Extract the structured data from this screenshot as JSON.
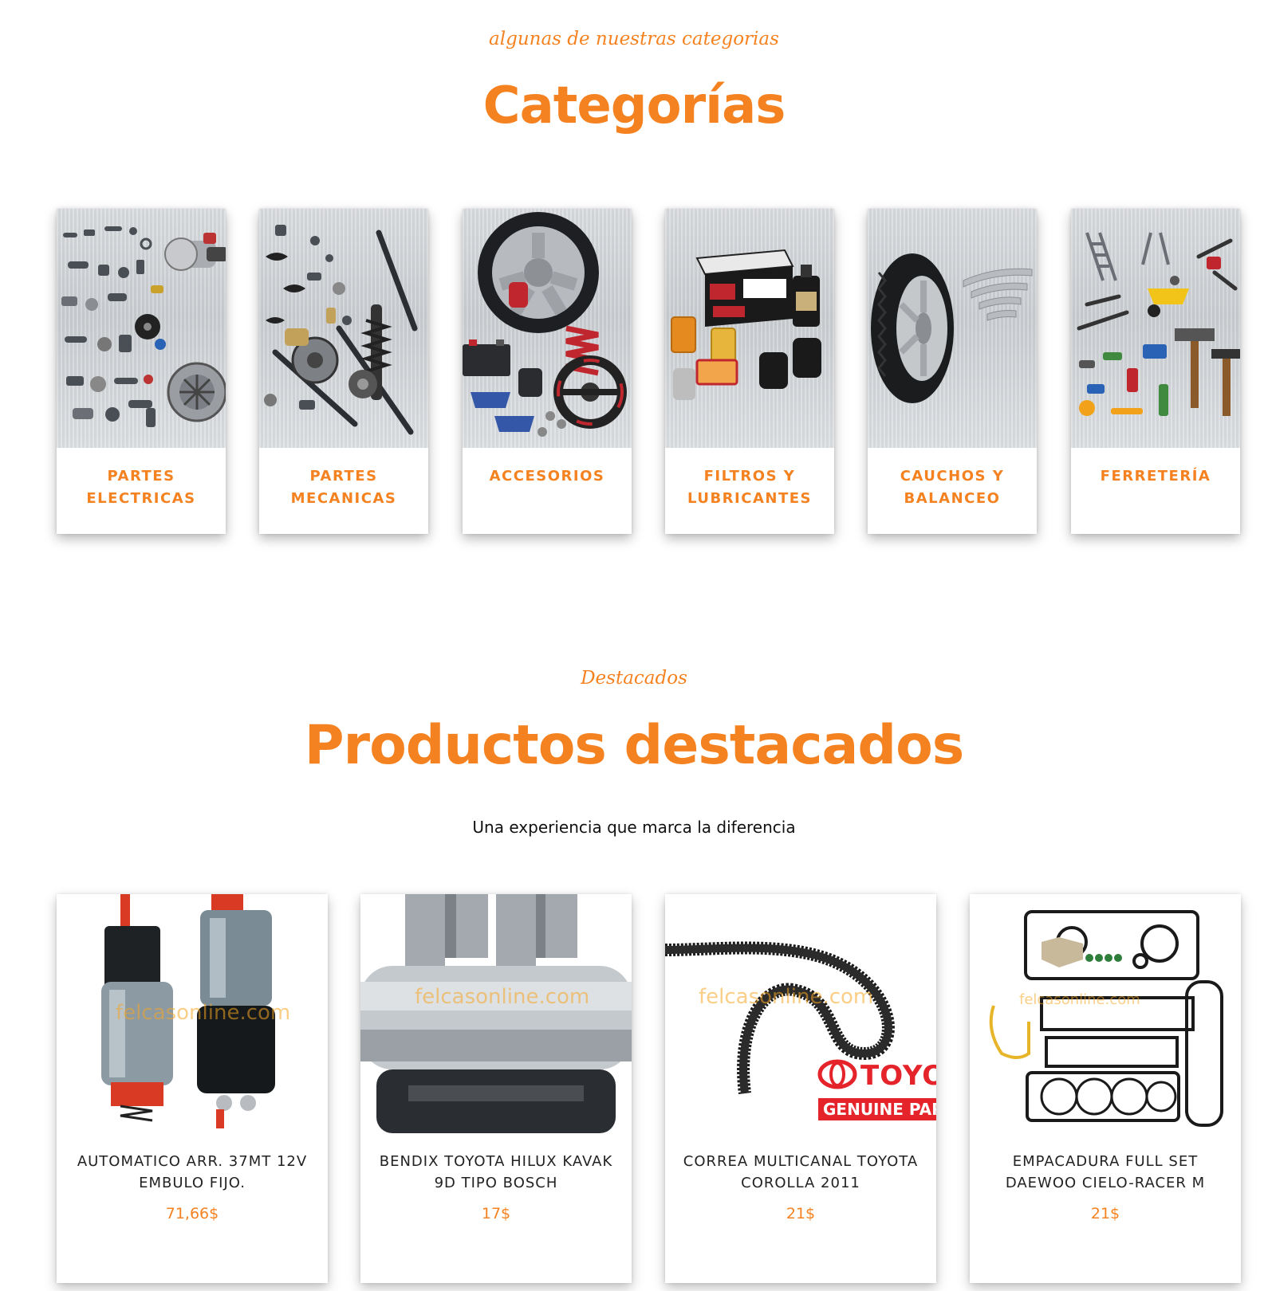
{
  "categories_section": {
    "eyebrow": "algunas de nuestras categorias",
    "title": "Categorías",
    "items": [
      {
        "label": "PARTES ELECTRICAS",
        "image": "electrical-parts-image"
      },
      {
        "label": "PARTES MECANICAS",
        "image": "mechanical-parts-image"
      },
      {
        "label": "ACCESORIOS",
        "image": "accessories-image"
      },
      {
        "label": "FILTROS Y LUBRICANTES",
        "image": "filters-lubricants-image"
      },
      {
        "label": "CAUCHOS Y BALANCEO",
        "image": "tires-balancing-image"
      },
      {
        "label": "FERRETERÍA",
        "image": "hardware-tools-image"
      }
    ]
  },
  "products_section": {
    "eyebrow": "Destacados",
    "title": "Productos destacados",
    "subtitle": "Una experiencia que marca la diferencia",
    "items": [
      {
        "name": "AUTOMATICO ARR. 37MT 12V EMBULO FIJO.",
        "price": "71,66$",
        "watermark": "felcasonline.com"
      },
      {
        "name": "BENDIX TOYOTA HILUX KAVAK 9D TIPO BOSCH",
        "price": "17$",
        "watermark": "felcasonline.com"
      },
      {
        "name": "CORREA MULTICANAL TOYOTA COROLLA 2011",
        "price": "21$",
        "watermark": "felcasonline.com",
        "brand_text": "TOYO",
        "brand_sub": "GENUINE PAR"
      },
      {
        "name": "EMPACADURA FULL SET DAEWOO CIELO-RACER M",
        "price": "21$",
        "watermark": "felcasonline.com"
      }
    ]
  },
  "colors": {
    "accent": "#f58220",
    "text": "#222222",
    "background": "#ffffff"
  }
}
